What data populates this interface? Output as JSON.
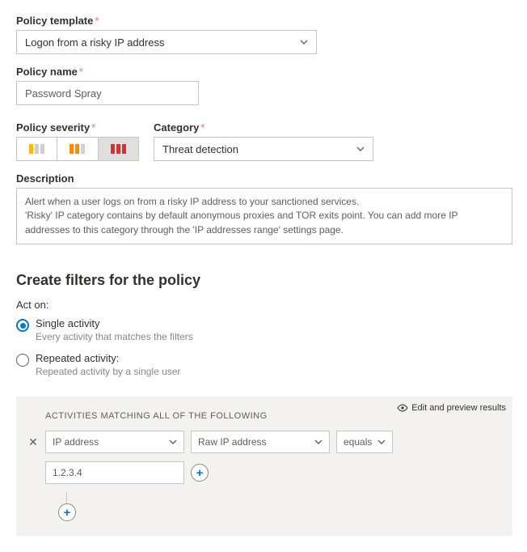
{
  "labels": {
    "policy_template": "Policy template",
    "policy_name": "Policy name",
    "policy_severity": "Policy severity",
    "category": "Category",
    "description": "Description",
    "asterisk": "*"
  },
  "values": {
    "policy_template": "Logon from a risky IP address",
    "policy_name": "Password Spray",
    "category": "Threat detection",
    "description_line1": "Alert when a user logs on from a risky IP address to your sanctioned services.",
    "description_line2": "'Risky' IP category contains by default anonymous proxies and TOR exits point. You can add more IP addresses to this category through the 'IP addresses range' settings page."
  },
  "filters_section": {
    "heading": "Create filters for the policy",
    "acton_label": "Act on:",
    "radio_single": {
      "title": "Single activity",
      "sub": "Every activity that matches the filters"
    },
    "radio_repeated": {
      "title": "Repeated activity:",
      "sub": "Repeated activity by a single user"
    }
  },
  "filter_panel": {
    "preview": "Edit and preview results",
    "title": "ACTIVITIES MATCHING ALL OF THE FOLLOWING",
    "filter1_field": "IP address",
    "filter1_subfield": "Raw IP address",
    "filter1_op": "equals",
    "filter1_value": "1.2.3.4"
  }
}
